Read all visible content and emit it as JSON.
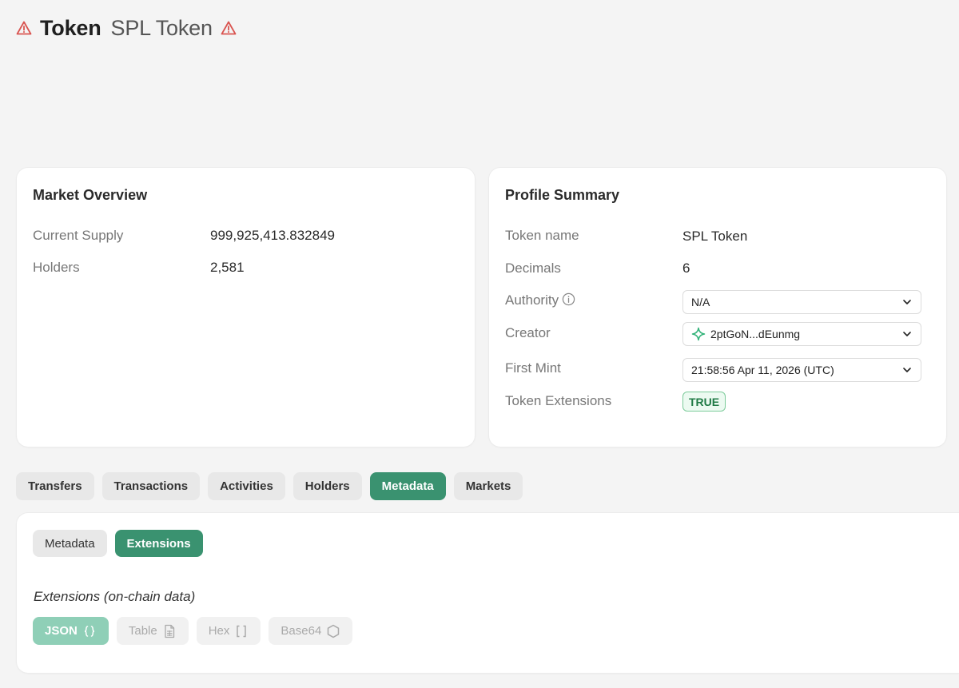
{
  "header": {
    "title": "Token",
    "subtitle": "SPL Token"
  },
  "market": {
    "title": "Market Overview",
    "rows": [
      {
        "label": "Current Supply",
        "value": "999,925,413.832849"
      },
      {
        "label": "Holders",
        "value": "2,581"
      }
    ]
  },
  "profile": {
    "title": "Profile Summary",
    "token_name_label": "Token name",
    "token_name": "SPL Token",
    "decimals_label": "Decimals",
    "decimals": "6",
    "authority_label": "Authority",
    "authority_value": "N/A",
    "creator_label": "Creator",
    "creator_value": "2ptGoN...dEunmg",
    "first_mint_label": "First Mint",
    "first_mint_value": "21:58:56 Apr 11, 2026 (UTC)",
    "extensions_label": "Token Extensions",
    "extensions_value": "TRUE"
  },
  "tabs": [
    {
      "label": "Transfers"
    },
    {
      "label": "Transactions"
    },
    {
      "label": "Activities"
    },
    {
      "label": "Holders"
    },
    {
      "label": "Metadata",
      "active": true
    },
    {
      "label": "Markets"
    }
  ],
  "panel": {
    "subtabs": [
      {
        "label": "Metadata"
      },
      {
        "label": "Extensions",
        "active": true
      }
    ],
    "heading": "Extensions (on-chain data)",
    "formats": [
      {
        "label": "JSON",
        "icon": "braces-icon",
        "active": true
      },
      {
        "label": "Table",
        "icon": "table-file-icon"
      },
      {
        "label": "Hex",
        "icon": "brackets-icon"
      },
      {
        "label": "Base64",
        "icon": "hexagon-icon"
      }
    ]
  },
  "colors": {
    "accent": "#3a9270",
    "accent_light": "#8fcfb7",
    "warning": "#d9534f",
    "badge_green": "#1f7a45"
  }
}
